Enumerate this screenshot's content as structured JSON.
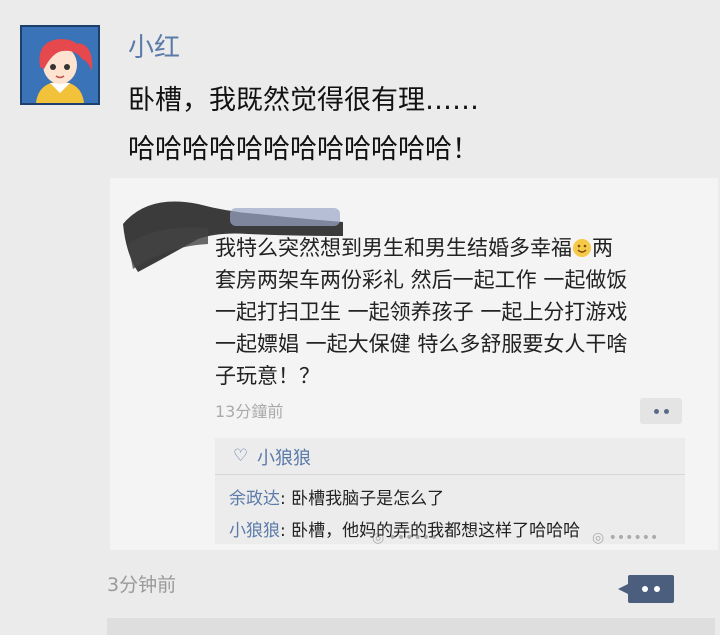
{
  "post": {
    "author": "小红",
    "text_line1": "卧槽，我既然觉得很有理……",
    "text_line2": "哈哈哈哈哈哈哈哈哈哈哈哈！",
    "time": "3分钟前"
  },
  "embedded": {
    "body_lines": [
      "我特么突然想到男生和男生结婚多幸福",
      "套房两架车两份彩礼 然后一起工作 一起做饭",
      "一起打扫卫生 一起领养孩子 一起上分打游戏",
      "一起嫖娼 一起大保健 特么多舒服要女人干啥",
      "子玩意！？"
    ],
    "line1_suffix": "两",
    "time": "13分鐘前",
    "like_name": "小狼狼",
    "comments": [
      {
        "name": "余政达",
        "sep": ": ",
        "text": "卧槽我脑子是怎么了"
      },
      {
        "name": "小狼狼",
        "sep": ": ",
        "text": "卧槽，他妈的弄的我都想这样了哈哈哈"
      }
    ]
  },
  "colors": {
    "link_blue": "#5b7baa",
    "background": "#ebebeb",
    "more_button": "#4b5e7e"
  },
  "icons": {
    "avatar": "cartoon-girl-red-hair",
    "emoji": "smile-emoji",
    "like": "heart-outline-icon",
    "more": "ellipsis-comment-icon"
  }
}
